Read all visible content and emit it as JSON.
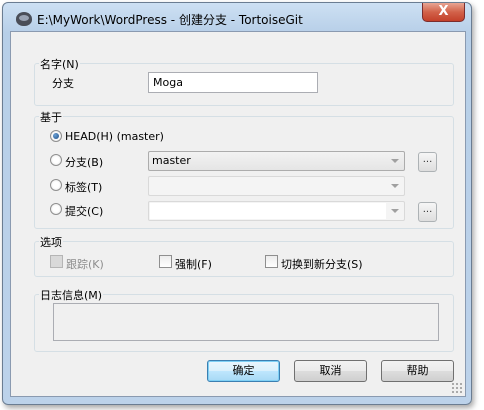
{
  "window": {
    "title": "E:\\MyWork\\WordPress - 创建分支 - TortoiseGit",
    "close_label": "X"
  },
  "name_group": {
    "title": "名字(N)",
    "branch_label": "分支",
    "branch_value": "Moga"
  },
  "base_group": {
    "title": "基于",
    "head_label": "HEAD(H) (master)",
    "branch_label": "分支(B)",
    "branch_value": "master",
    "tag_label": "标签(T)",
    "commit_label": "提交(C)",
    "browse_label": "..."
  },
  "options_group": {
    "title": "选项",
    "track_label": "跟踪(K)",
    "force_label": "强制(F)",
    "switch_label": "切换到新分支(S)"
  },
  "log_group": {
    "title": "日志信息(M)"
  },
  "buttons": {
    "ok": "确定",
    "cancel": "取消",
    "help": "帮助"
  }
}
